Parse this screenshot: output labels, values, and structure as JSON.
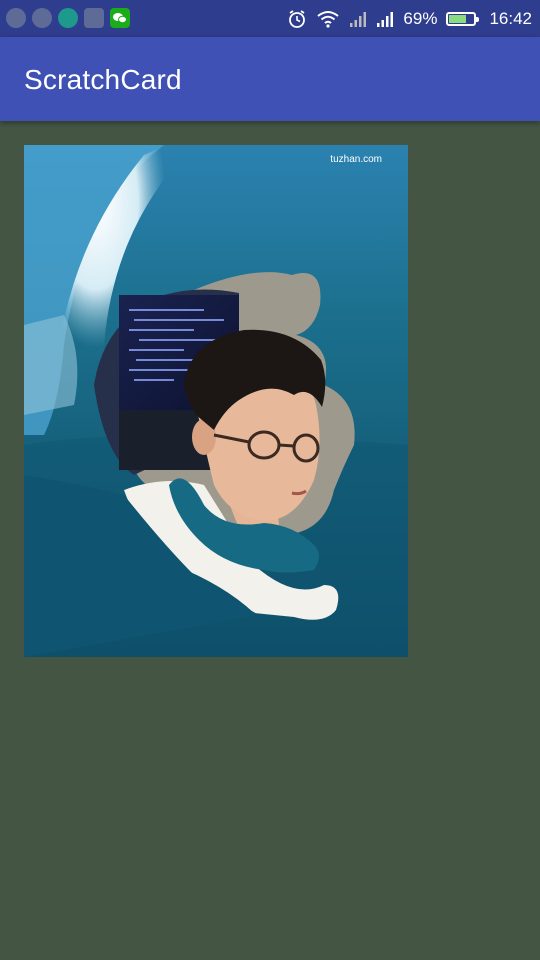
{
  "status_bar": {
    "notification_icons": [
      "notification-app-icon-1",
      "notification-app-icon-2",
      "notification-app-icon-3",
      "notification-app-icon-4",
      "wechat-icon"
    ],
    "battery_percent_label": "69%",
    "battery_level": 0.69,
    "time": "16:42"
  },
  "app_bar": {
    "title": "ScratchCard"
  },
  "scratch_card": {
    "watermark": "tuzhan.com",
    "top_image": "ocean-wave-photo",
    "revealed_image": "portrait-photo"
  },
  "colors": {
    "status_bar": "#2f3d8f",
    "app_bar": "#3f51b5",
    "background": "#445544"
  }
}
